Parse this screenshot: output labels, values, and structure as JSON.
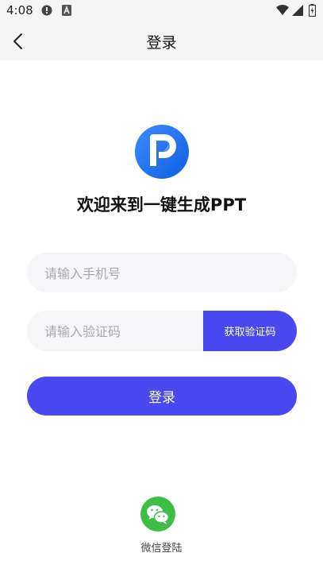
{
  "status_bar": {
    "time": "4:08"
  },
  "header": {
    "title": "登录"
  },
  "welcome": {
    "text": "欢迎来到一键生成PPT"
  },
  "form": {
    "phone_placeholder": "请输入手机号",
    "code_placeholder": "请输入验证码",
    "get_code_label": "获取验证码",
    "login_label": "登录"
  },
  "wechat": {
    "label": "微信登陆"
  },
  "colors": {
    "accent": "#4a48f0",
    "wechat": "#3cbf44",
    "logo": "#1a73f0"
  }
}
